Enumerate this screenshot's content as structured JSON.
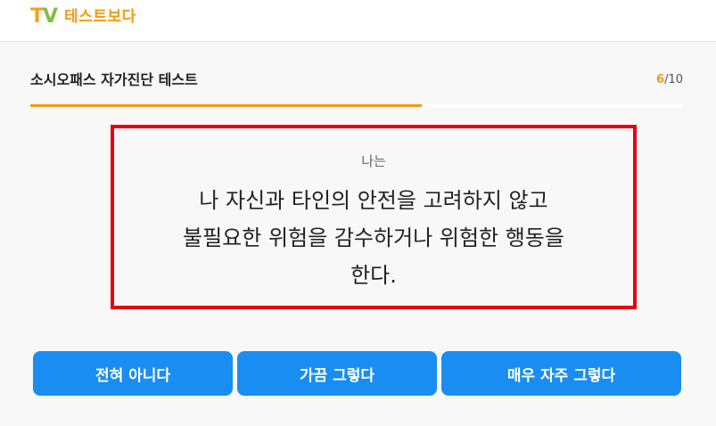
{
  "header": {
    "logo_tv": "TV",
    "logo_text": "테스트보다"
  },
  "test": {
    "title": "소시오패스 자가진단 테스트",
    "current": "6",
    "total_text": "/10",
    "progress_fraction": 0.6
  },
  "question": {
    "prefix": "나는",
    "lines": [
      "나 자신과 타인의 안전을 고려하지 않고",
      "불필요한 위험을 감수하거나 위험한 행동을",
      "한다."
    ]
  },
  "answers": [
    {
      "label": "전혀 아니다"
    },
    {
      "label": "가끔 그렇다"
    },
    {
      "label": "매우 자주 그렇다"
    }
  ],
  "colors": {
    "accent": "#f39a12",
    "button": "#1a8df2",
    "highlight_border": "#e50012"
  }
}
